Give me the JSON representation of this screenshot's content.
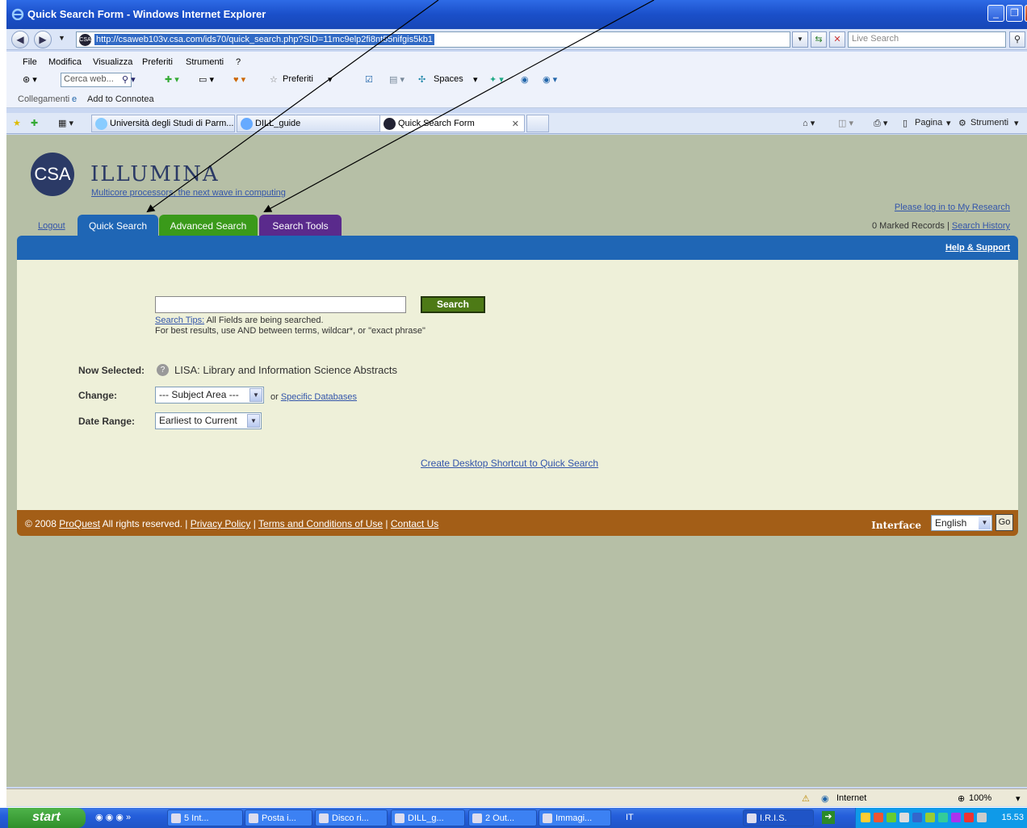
{
  "window": {
    "title": "Quick Search Form - Windows Internet Explorer"
  },
  "address": {
    "url": "http://csaweb103v.csa.com/ids70/quick_search.php?SID=11mc9elp2fi8nt55nifgis5kb1",
    "live_search_placeholder": "Live Search"
  },
  "menu": {
    "items": [
      "File",
      "Modifica",
      "Visualizza",
      "Preferiti",
      "Strumenti",
      "?"
    ]
  },
  "toolbar": {
    "search_placeholder": "Cerca web...",
    "favorites": "Preferiti",
    "spaces": "Spaces"
  },
  "links_bar": {
    "label": "Collegamenti",
    "item": "Add to Connotea"
  },
  "browser_tabs": [
    {
      "label": "Università degli Studi di Parm..."
    },
    {
      "label": "DILL_guide"
    },
    {
      "label": "Quick Search Form"
    }
  ],
  "command_bar": {
    "page": "Pagina",
    "tools": "Strumenti"
  },
  "site": {
    "logo_badge": "CSA",
    "logo_name": "ILLUMINA",
    "tagline": "Multicore processors, the next wave in computing",
    "login_link": "Please log in to My Research",
    "marked_records": "0 Marked Records",
    "separator": "|",
    "search_history": "Search History",
    "logout": "Logout",
    "tabs": {
      "quick": "Quick Search",
      "advanced": "Advanced Search",
      "tools": "Search Tools"
    },
    "help": "Help & Support"
  },
  "form": {
    "search_value": "",
    "search_button": "Search",
    "tips_link": "Search Tips:",
    "tips_text1": " All Fields are being searched.",
    "tips_text2": "For best results, use AND between terms, wildcar*, or \"exact phrase\"",
    "now_selected_label": "Now Selected:",
    "help_icon_text": "?",
    "database": "LISA: Library and Information Science Abstracts",
    "change_label": "Change:",
    "subject_area": "--- Subject Area ---",
    "or_text": "or ",
    "specific_db": "Specific Databases",
    "date_label": "Date Range:",
    "date_value": "Earliest to Current",
    "shortcut": "Create Desktop Shortcut to Quick Search"
  },
  "footer": {
    "copyright": "© 2008 ",
    "proquest": "ProQuest",
    "rights": " All rights reserved.  |  ",
    "privacy": "Privacy Policy",
    "sep": " | ",
    "terms": "Terms and Conditions of Use",
    "sep2": " |  ",
    "contact": "Contact Us",
    "interface_label": "Interface",
    "language": "English",
    "go": "Go"
  },
  "status": {
    "zone": "Internet",
    "zoom": "100%"
  },
  "taskbar": {
    "start": "start",
    "tasks": [
      "5 Int...",
      "Posta i...",
      "Disco ri...",
      "DILL_g...",
      "2 Out...",
      "Immagi..."
    ],
    "lang": "IT",
    "iris": "I.R.I.S.",
    "time": "15.53"
  }
}
